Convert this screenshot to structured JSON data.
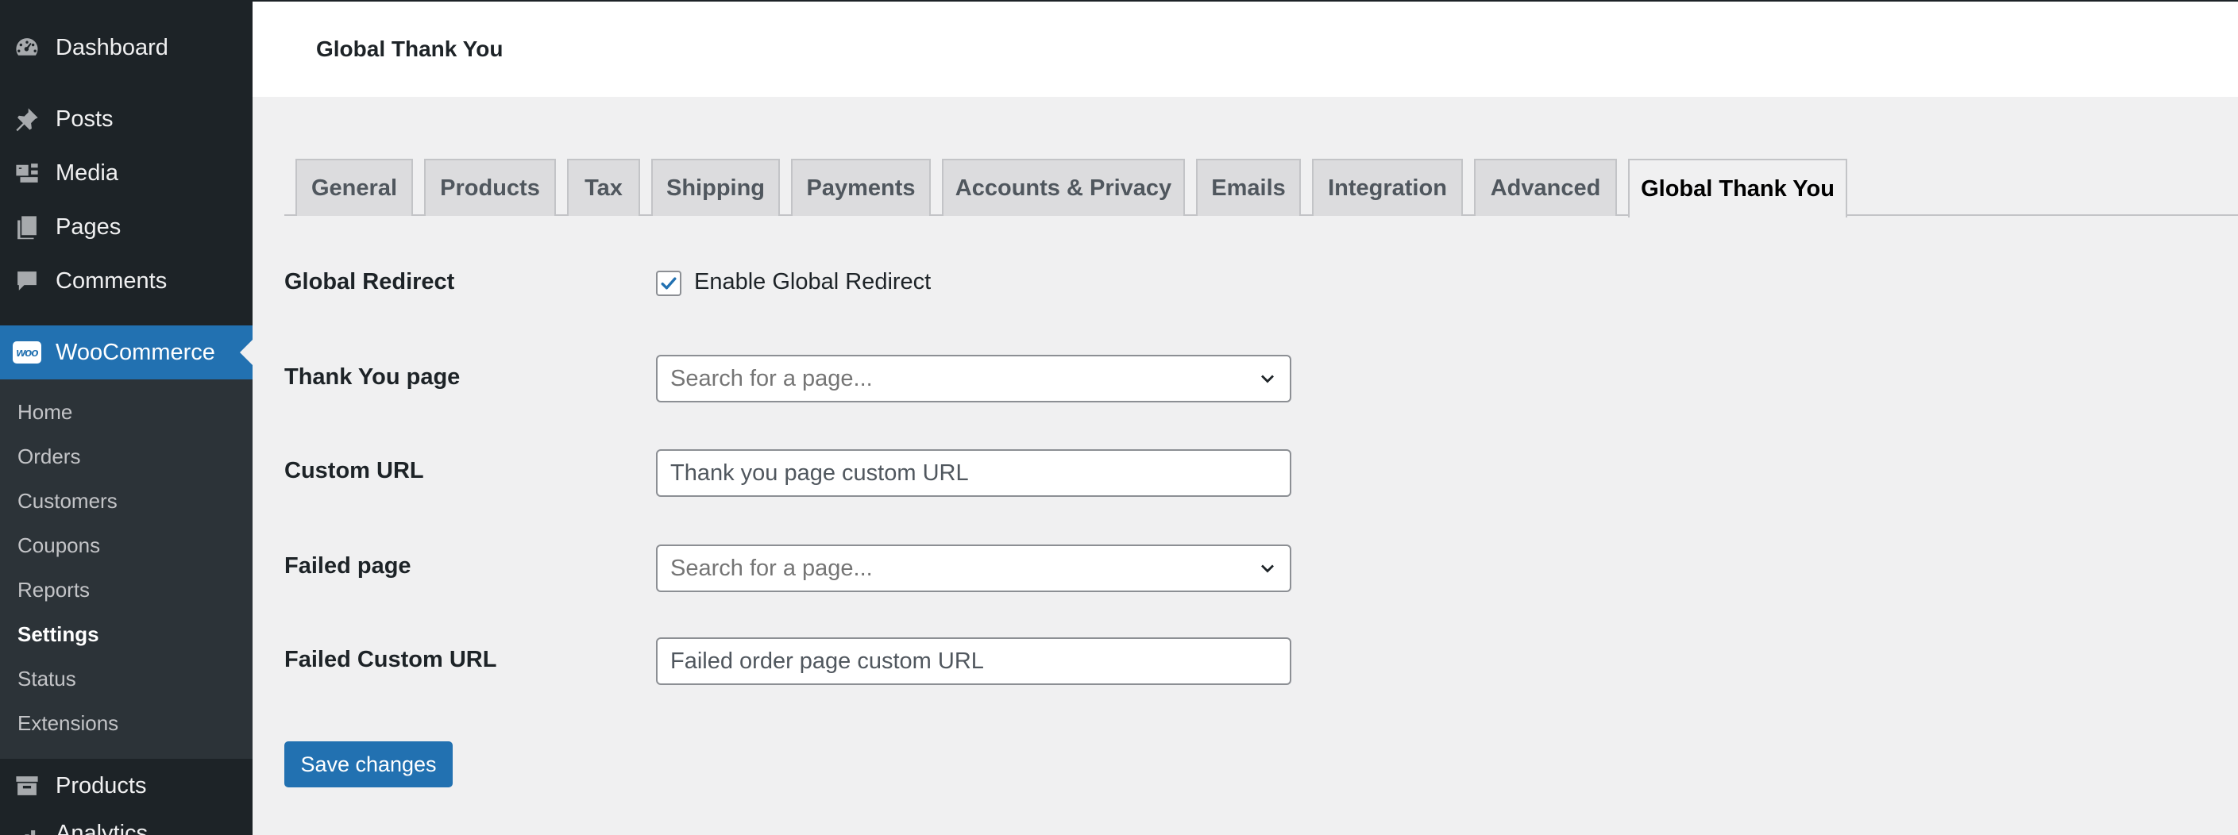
{
  "sidebar": {
    "items": [
      {
        "label": "Dashboard",
        "icon": "dashboard-icon"
      },
      {
        "label": "Posts",
        "icon": "pin-icon"
      },
      {
        "label": "Media",
        "icon": "media-icon"
      },
      {
        "label": "Pages",
        "icon": "pages-icon"
      },
      {
        "label": "Comments",
        "icon": "comment-icon"
      },
      {
        "label": "WooCommerce",
        "icon": "woocommerce-icon",
        "badge": "woo"
      },
      {
        "label": "Products",
        "icon": "archive-icon"
      },
      {
        "label": "Analytics",
        "icon": "chart-icon"
      }
    ],
    "submenu": [
      "Home",
      "Orders",
      "Customers",
      "Coupons",
      "Reports",
      "Settings",
      "Status",
      "Extensions"
    ],
    "active_submenu": "Settings"
  },
  "header": {
    "title": "Global Thank You"
  },
  "tabs": [
    {
      "label": "General"
    },
    {
      "label": "Products"
    },
    {
      "label": "Tax"
    },
    {
      "label": "Shipping"
    },
    {
      "label": "Payments"
    },
    {
      "label": "Accounts & Privacy"
    },
    {
      "label": "Emails"
    },
    {
      "label": "Integration"
    },
    {
      "label": "Advanced"
    },
    {
      "label": "Global Thank You"
    }
  ],
  "form": {
    "global_redirect": {
      "label": "Global Redirect",
      "checkbox_label": "Enable Global Redirect",
      "checked": true
    },
    "thank_you_page": {
      "label": "Thank You page",
      "placeholder": "Search for a page..."
    },
    "custom_url": {
      "label": "Custom URL",
      "placeholder": "Thank you page custom URL"
    },
    "failed_page": {
      "label": "Failed page",
      "placeholder": "Search for a page..."
    },
    "failed_custom_url": {
      "label": "Failed Custom URL",
      "placeholder": "Failed order page custom URL"
    },
    "save_label": "Save changes"
  },
  "colors": {
    "accent": "#2271b1",
    "sidebar": "#1d2327",
    "submenu": "#2c3338"
  }
}
